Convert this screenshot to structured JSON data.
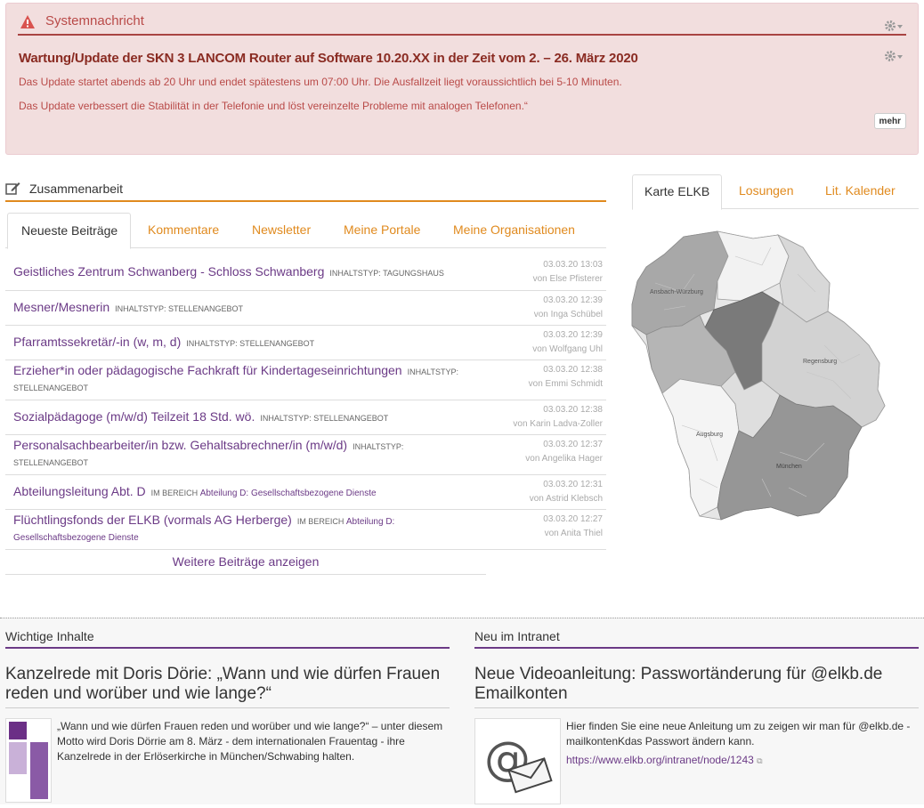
{
  "system_message": {
    "label": "Systemnachricht",
    "heading": "Wartung/Update der SKN 3 LANCOM Router auf Software 10.20.XX in der Zeit vom 2. – 26. März 2020",
    "paragraph_1": "Das Update startet abends ab 20 Uhr und endet spätestens um 07:00 Uhr. Die Ausfallzeit liegt voraussichtlich bei 5-10 Minuten.",
    "paragraph_2": "Das Update verbessert die Stabilität in der Telefonie und löst vereinzelte Probleme mit analogen Telefonen.“",
    "more_button": "mehr"
  },
  "collab": {
    "title": "Zusammenarbeit",
    "tabs": [
      "Neueste Beiträge",
      "Kommentare",
      "Newsletter",
      "Meine Portale",
      "Meine Organisationen"
    ],
    "posts": [
      {
        "title": "Geistliches Zentrum Schwanberg - Schloss Schwanberg",
        "type_label": "INHALTSTYP:",
        "type_value": "TAGUNGSHAUS",
        "date": "03.03.20 13:03",
        "author": "von Else Pfisterer"
      },
      {
        "title": "Mesner/Mesnerin",
        "type_label": "INHALTSTYP:",
        "type_value": "STELLENANGEBOT",
        "date": "03.03.20 12:39",
        "author": "von Inga Schübel"
      },
      {
        "title": "Pfarramtssekretär/-in (w, m, d)",
        "type_label": "INHALTSTYP:",
        "type_value": "STELLENANGEBOT",
        "date": "03.03.20 12:39",
        "author": "von Wolfgang Uhl"
      },
      {
        "title": "Erzieher*in oder pädagogische Fachkraft für Kindertageseinrichtungen",
        "type_label": "INHALTSTYP:",
        "type_value": "STELLENANGEBOT",
        "date": "03.03.20 12:38",
        "author": "von Emmi Schmidt"
      },
      {
        "title": "Sozialpädagoge (m/w/d) Teilzeit 18 Std. wö.",
        "type_label": "INHALTSTYP:",
        "type_value": "STELLENANGEBOT",
        "date": "03.03.20 12:38",
        "author": "von Karin Ladva-Zoller"
      },
      {
        "title": "Personalsachbearbeiter/in bzw. Gehaltsabrechner/in (m/w/d)",
        "type_label": "INHALTSTYP:",
        "type_value": "STELLENANGEBOT",
        "date": "03.03.20 12:37",
        "author": "von Angelika Hager"
      },
      {
        "title": "Abteilungsleitung Abt. D",
        "type_label": "IM BEREICH",
        "type_value": "Abteilung D: Gesellschaftsbezogene Dienste",
        "date": "03.03.20 12:31",
        "author": "von Astrid Klebsch"
      },
      {
        "title": "Flüchtlingsfonds der ELKB (vormals AG Herberge)",
        "type_label": "IM BEREICH",
        "type_value": "Abteilung D: Gesellschaftsbezogene Dienste",
        "type_value_a": "Abteilung D:",
        "type_value_b": "Gesellschaftsbezogene Dienste",
        "date": "03.03.20 12:27",
        "author": "von Anita Thiel"
      }
    ],
    "more_link": "Weitere Beiträge anzeigen"
  },
  "right_tabs": [
    "Karte ELKB",
    "Losungen",
    "Lit. Kalender"
  ],
  "map": {
    "labels": [
      "Ansbach-Würzburg",
      "Regensburg",
      "Augsburg",
      "München"
    ]
  },
  "important": {
    "section": "Wichtige Inhalte",
    "title": "Kanzelrede mit Doris Dörie: „Wann und wie dürfen Frauen reden und worüber und wie lange?“",
    "text": "„Wann und wie dürfen Frauen reden und worüber und wie lange?“ – unter diesem Motto wird Doris Dörrie am 8. März - dem internationalen Frauentag - ihre Kanzelrede in der Erlöserkirche in München/Schwabing halten."
  },
  "new_intranet": {
    "section": "Neu im Intranet",
    "title": "Neue Videoanleitung: Passwortänderung für @elkb.de Emailkonten",
    "text": "Hier finden Sie eine neue Anleitung um zu zeigen wir man für @elkb.de -mailkontenKdas Passwort ändern kann.",
    "link": "https://www.elkb.org/intranet/node/1243"
  },
  "colors": {
    "accent_orange": "#e08a1e",
    "accent_purple": "#6b3a86",
    "alert_bg": "#f2dede",
    "alert_text": "#b94a48"
  }
}
